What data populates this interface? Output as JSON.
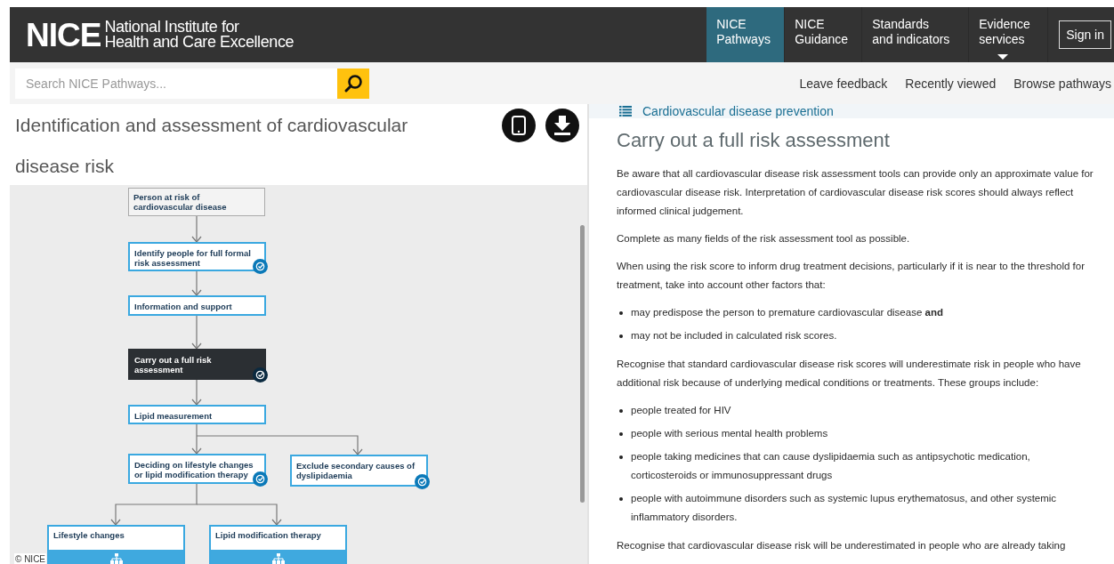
{
  "logo": {
    "mark": "NICE",
    "name_lines": [
      "National Institute for",
      "Health and Care Excellence"
    ]
  },
  "nav": [
    {
      "label_lines": [
        "NICE",
        "Pathways"
      ],
      "selected": true,
      "dropdown": false
    },
    {
      "label_lines": [
        "NICE",
        "Guidance"
      ],
      "selected": false,
      "dropdown": false
    },
    {
      "label_lines": [
        "Standards",
        "and indicators"
      ],
      "selected": false,
      "dropdown": false
    },
    {
      "label_lines": [
        "Evidence",
        "services"
      ],
      "selected": false,
      "dropdown": true
    }
  ],
  "sign_in": "Sign in",
  "search": {
    "placeholder": "Search NICE Pathways..."
  },
  "sub_links": [
    "Leave feedback",
    "Recently viewed",
    "Browse pathways"
  ],
  "pathway": {
    "title": "Identification and assessment of cardiovascular disease risk",
    "nodes": [
      {
        "label": "Person at risk of cardiovascular disease",
        "kind": "start",
        "selected": false,
        "badge": false
      },
      {
        "label": "Identify people for full formal risk assessment",
        "kind": "step",
        "selected": false,
        "badge": true
      },
      {
        "label": "Information and support",
        "kind": "step",
        "selected": false,
        "badge": false
      },
      {
        "label": "Carry out a full risk assessment",
        "kind": "step",
        "selected": true,
        "badge": true
      },
      {
        "label": "Lipid measurement",
        "kind": "step",
        "selected": false,
        "badge": false
      },
      {
        "label": "Deciding on lifestyle changes or lipid modification therapy",
        "kind": "step",
        "selected": false,
        "badge": true
      },
      {
        "label": "Exclude secondary causes of dyslipidaemia",
        "kind": "step",
        "selected": false,
        "badge": true
      },
      {
        "label": "Lifestyle changes",
        "kind": "group",
        "selected": false,
        "badge": false
      },
      {
        "label": "Lipid modification therapy",
        "kind": "group",
        "selected": false,
        "badge": false
      }
    ],
    "copyright": "© NICE"
  },
  "detail": {
    "breadcrumb": "Cardiovascular disease prevention",
    "heading": "Carry out a full risk assessment",
    "blocks": [
      {
        "kind": "para",
        "text": "Be aware that all cardiovascular disease risk assessment tools can provide only an approximate value for cardiovascular disease risk. Interpretation of cardiovascular disease risk scores should always reflect informed clinical judgement."
      },
      {
        "kind": "para",
        "text": "Complete as many fields of the risk assessment tool as possible."
      },
      {
        "kind": "para",
        "text": "When using the risk score to inform drug treatment decisions, particularly if it is near to the threshold for treatment, take into account other factors that:"
      },
      {
        "kind": "list",
        "items": [
          "may predispose the person to premature cardiovascular disease **and**",
          "may not be included in calculated risk scores."
        ]
      },
      {
        "kind": "para",
        "text": "Recognise that standard cardiovascular disease risk scores will underestimate risk in people who have additional risk because of underlying medical conditions or treatments. These groups include:"
      },
      {
        "kind": "list",
        "items": [
          "people treated for HIV",
          "people with serious mental health problems",
          "people taking medicines that can cause dyslipidaemia such as antipsychotic medication, corticosteroids or immunosuppressant drugs",
          "people with autoimmune disorders such as systemic lupus erythematosus, and other systemic inflammatory disorders."
        ]
      },
      {
        "kind": "para",
        "text": "Recognise that cardiovascular disease risk will be underestimated in people who are already taking"
      }
    ]
  }
}
